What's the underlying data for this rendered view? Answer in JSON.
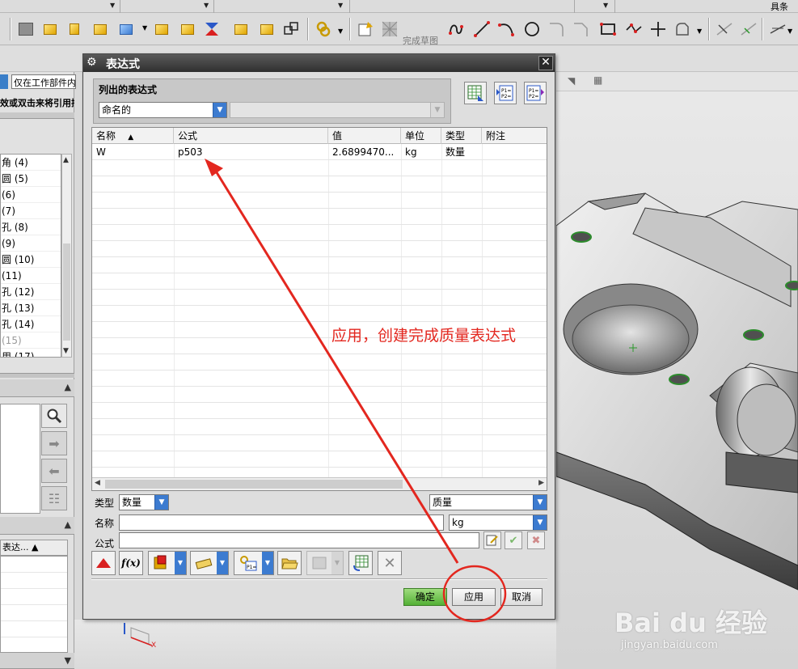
{
  "top_toolbar": {
    "right_label": "具条",
    "finish_sketch_label": "完成草图"
  },
  "left_panel": {
    "filter_value": "仅在工作部件内",
    "hint_text": "效或双击来将引用插",
    "feature_items": [
      "角 (4)",
      "圆 (5)",
      " (6)",
      " (7)",
      "孔 (8)",
      " (9)",
      "圆 (10)",
      " (11)",
      "孔 (12)",
      "孔 (13)",
      "孔 (14)",
      " (15)",
      "用 (17)"
    ],
    "table_header": "表达..."
  },
  "dialog": {
    "title": "表达式",
    "listed_group_label": "列出的表达式",
    "listed_filter_value": "命名的",
    "columns": [
      "名称",
      "公式",
      "值",
      "单位",
      "类型",
      "附注"
    ],
    "rows": [
      {
        "name": "W",
        "formula": "p503",
        "value": "2.6899470...",
        "unit": "kg",
        "type": "数量",
        "note": ""
      }
    ],
    "type_label": "类型",
    "type_value": "数量",
    "dimension_value": "质量",
    "name_label": "名称",
    "name_value": "",
    "unit_value": "kg",
    "formula_label": "公式",
    "formula_value": "",
    "ok_label": "确定",
    "apply_label": "应用",
    "cancel_label": "取消"
  },
  "annotation": {
    "text": "应用，创建完成质量表达式",
    "color": "#e3271f"
  },
  "watermark": {
    "main": "Bai du 经验",
    "sub": "jingyan.baidu.com"
  }
}
